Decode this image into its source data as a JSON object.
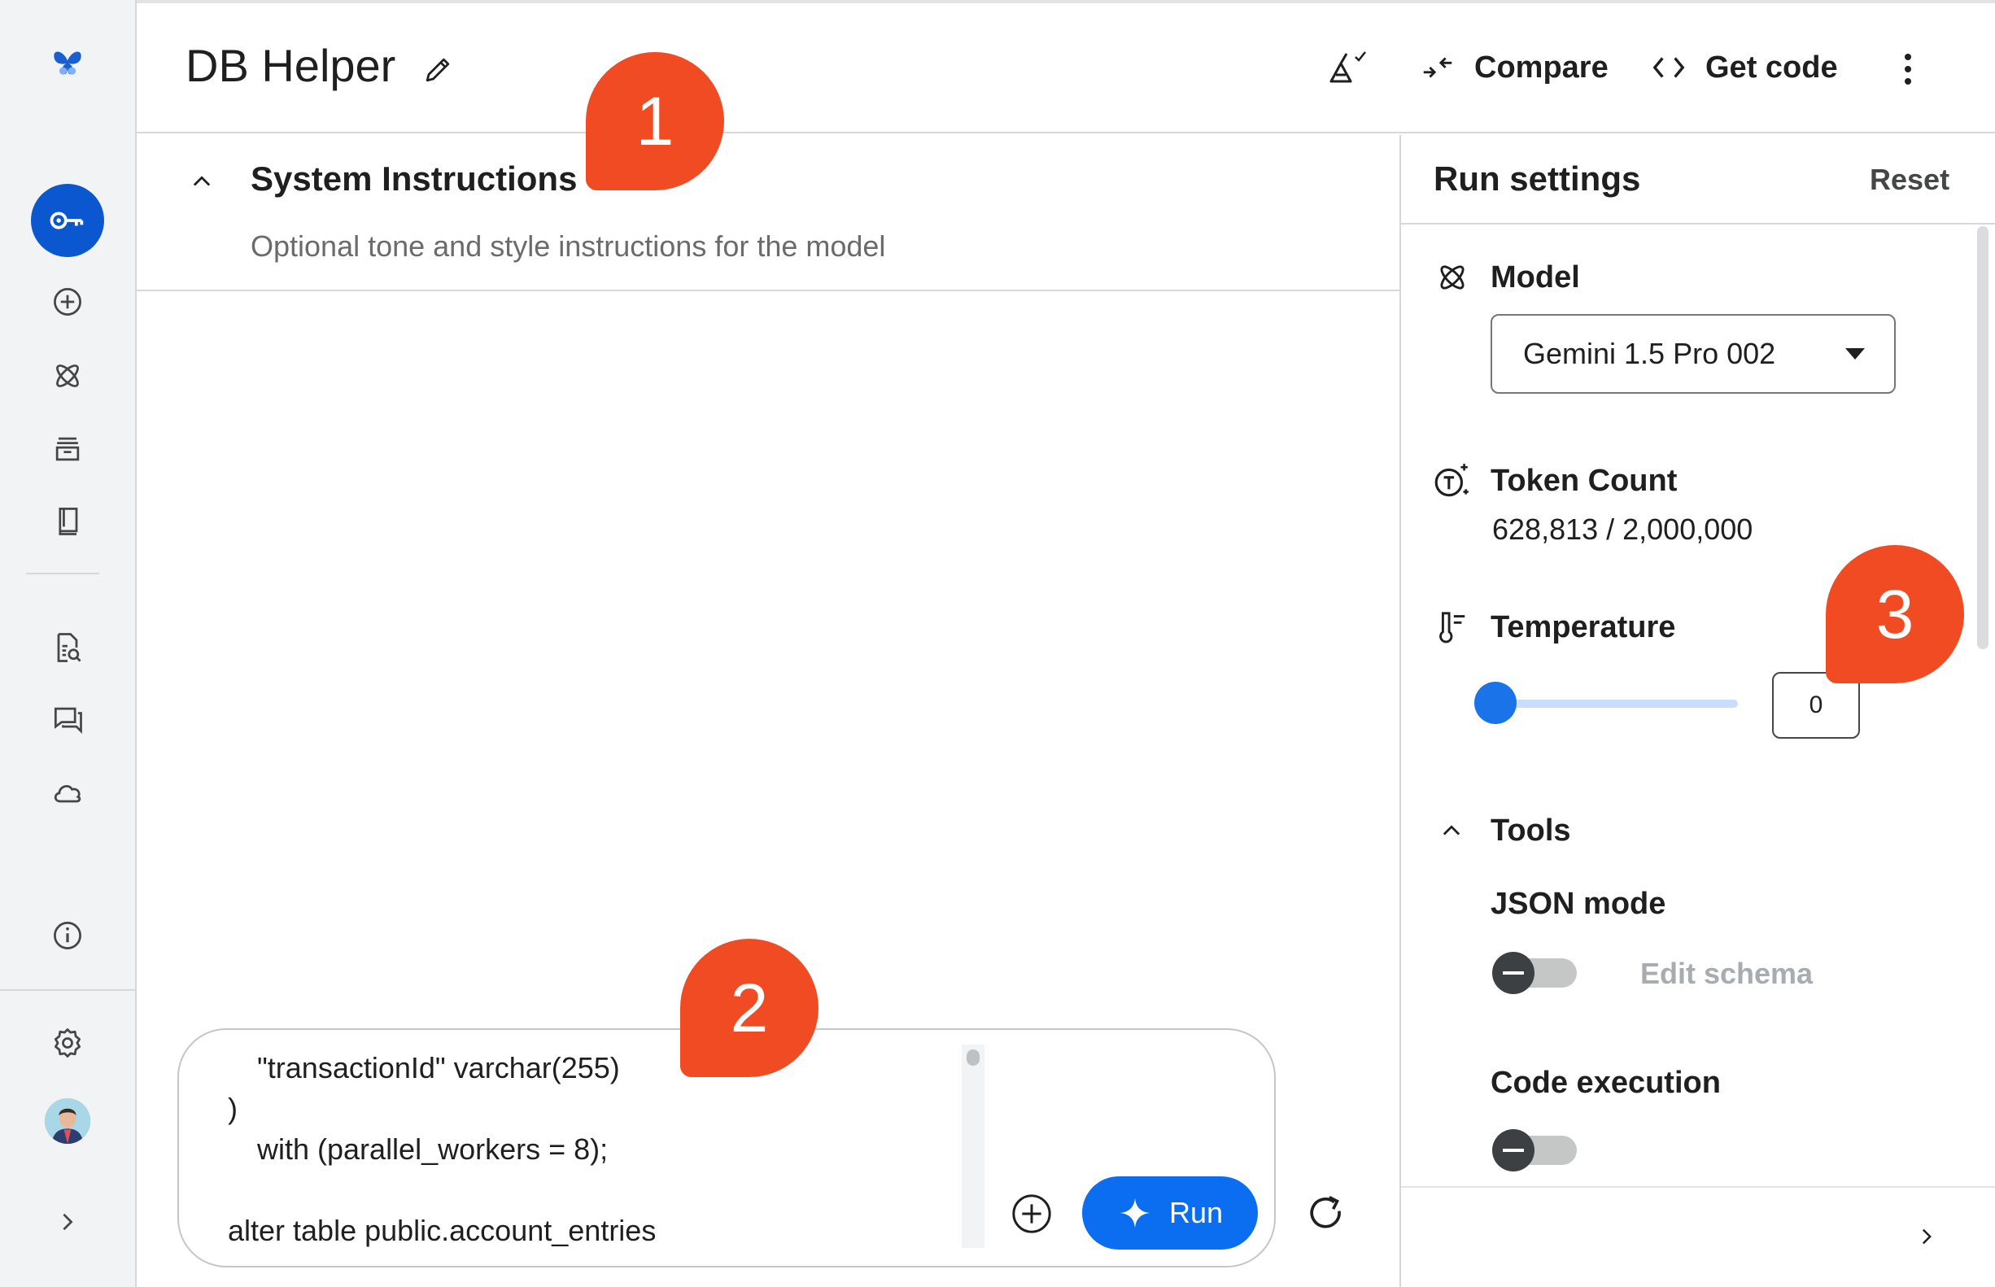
{
  "app": {
    "title": "DB Helper"
  },
  "topbar": {
    "compare_label": "Compare",
    "get_code_label": "Get code"
  },
  "system_instructions": {
    "heading": "System Instructions",
    "placeholder": "Optional tone and style instructions for the model"
  },
  "prompt": {
    "lines": [
      "\"transactionId\" varchar(255)",
      ")",
      "with (parallel_workers = 8);",
      "",
      "alter table public.account_entries"
    ],
    "run_label": "Run"
  },
  "run_settings": {
    "heading": "Run settings",
    "reset_label": "Reset",
    "model_label": "Model",
    "model_value": "Gemini 1.5 Pro 002",
    "token_count_label": "Token Count",
    "token_count_value": "628,813 / 2,000,000",
    "temperature_label": "Temperature",
    "temperature_value": "0",
    "tools_label": "Tools",
    "json_mode_label": "JSON mode",
    "edit_schema_label": "Edit schema",
    "code_execution_label": "Code execution"
  },
  "callouts": [
    "1",
    "2",
    "3"
  ],
  "colors": {
    "accent": "#0b57d0",
    "run_button": "#0b6df0",
    "callout": "#f04b23"
  },
  "icons": [
    "butterfly-logo-icon",
    "key-icon",
    "plus-circle-icon",
    "model-icon",
    "archive-icon",
    "book-icon",
    "doc-search-icon",
    "chat-icon",
    "cloud-icon",
    "info-icon",
    "gear-icon",
    "chevron-right-icon"
  ]
}
